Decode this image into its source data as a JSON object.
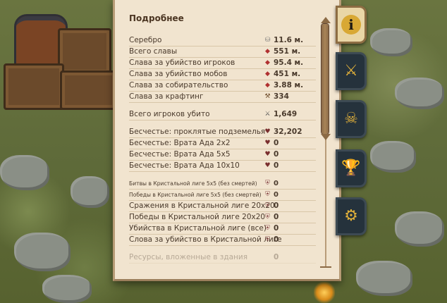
{
  "panel": {
    "title": "Подробнее",
    "rows": [
      {
        "label": "Серебро",
        "icon": "silver-coin-icon",
        "glyph": "⛁",
        "value": "11.6 м.",
        "kind": "silver"
      },
      {
        "label": "Всего славы",
        "icon": "fame-icon",
        "glyph": "◆",
        "value": "551 м.",
        "kind": "fame"
      },
      {
        "label": "Слава за убийство игроков",
        "icon": "fame-icon",
        "glyph": "◆",
        "value": "95.4 м.",
        "kind": "fame"
      },
      {
        "label": "Слава за убийство мобов",
        "icon": "fame-icon",
        "glyph": "◆",
        "value": "451 м.",
        "kind": "fame"
      },
      {
        "label": "Слава за собирательство",
        "icon": "fame-icon",
        "glyph": "◆",
        "value": "3.88 м.",
        "kind": "fame"
      },
      {
        "label": "Слава за крафтинг",
        "icon": "craft-icon",
        "glyph": "⚒",
        "value": "334",
        "kind": "craft"
      },
      {
        "gap": true
      },
      {
        "label": "Всего игроков убито",
        "icon": "crossed-swords-icon",
        "glyph": "⚔",
        "value": "1,649",
        "kind": "kill"
      },
      {
        "gap": true
      },
      {
        "label": "Бесчестье: проклятые подземелья",
        "icon": "infamy-icon",
        "glyph": "♥",
        "value": "32,202",
        "kind": "infamy"
      },
      {
        "label": "Бесчестье: Врата Ада 2x2",
        "icon": "infamy-icon",
        "glyph": "♥",
        "value": "0",
        "kind": "infamy"
      },
      {
        "label": "Бесчестье: Врата Ада 5x5",
        "icon": "infamy-icon",
        "glyph": "♥",
        "value": "0",
        "kind": "infamy"
      },
      {
        "label": "Бесчестье: Врата Ада 10x10",
        "icon": "infamy-icon",
        "glyph": "♥",
        "value": "0",
        "kind": "infamy"
      },
      {
        "gap": true
      },
      {
        "label": "Битвы в Кристальной лиге 5x5 (без смертей)",
        "icon": "crystal-shield-icon",
        "glyph": "⛨",
        "value": "0",
        "kind": "shield",
        "small": true
      },
      {
        "label": "Победы в Кристальной лиге 5x5 (без смертей)",
        "icon": "crystal-shield-icon",
        "glyph": "⛨",
        "value": "0",
        "kind": "shield",
        "small": true
      },
      {
        "label": "Сражения в Кристальной лиге 20x20",
        "icon": "crystal-shield-icon",
        "glyph": "⛨",
        "value": "0",
        "kind": "shield"
      },
      {
        "label": "Победы в Кристальной лиге 20x20",
        "icon": "crystal-shield-icon",
        "glyph": "⛨",
        "value": "0",
        "kind": "shield"
      },
      {
        "label": "Убийства в Кристальной лиге (все)",
        "icon": "crystal-shield-icon",
        "glyph": "⛨",
        "value": "0",
        "kind": "shield"
      },
      {
        "label": "Слова за убийство в Кристальной лиге",
        "icon": "crystal-shield-icon",
        "glyph": "⛨",
        "value": "0",
        "kind": "shield"
      },
      {
        "gap": true
      },
      {
        "label": "Ресурсы, вложенные в здания",
        "icon": "",
        "glyph": "",
        "value": "0",
        "kind": "plain",
        "faded": true
      }
    ]
  },
  "tabs": [
    {
      "name": "tab-info",
      "icon": "info-icon",
      "glyph": "i",
      "active": true
    },
    {
      "name": "tab-combat",
      "icon": "crossed-swords-icon",
      "glyph": "⚔",
      "active": false
    },
    {
      "name": "tab-pvp",
      "icon": "skull-crossbones-icon",
      "glyph": "☠",
      "active": false
    },
    {
      "name": "tab-achievements",
      "icon": "trophy-icon",
      "glyph": "🏆",
      "active": false
    },
    {
      "name": "tab-guild",
      "icon": "guild-globe-icon",
      "glyph": "⚙",
      "active": false
    }
  ],
  "colors": {
    "panel_bg": "#f1e4cf",
    "text": "#4a3a2c",
    "scrollbar": "#8c6b48",
    "tab_bg": "#25323c",
    "tab_active_bg": "#e9d6a6"
  }
}
